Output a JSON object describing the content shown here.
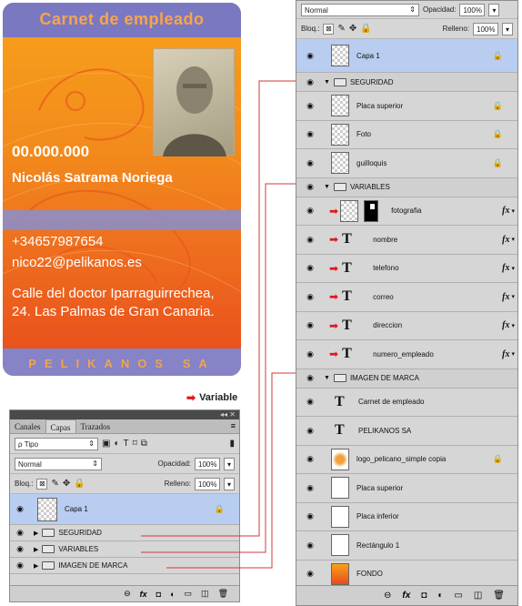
{
  "card": {
    "title": "Carnet de empleado",
    "number": "00.000.000",
    "name": "Nicolás Satrama Noriega",
    "phone": "+34657987654",
    "email": "nico22@pelikanos.es",
    "address": "Calle del doctor Iparraguirrechea, 24. Las Palmas de Gran Canaria.",
    "brand": "PELIKANOS SA"
  },
  "legend": {
    "label": "Variable",
    "color": "#e0171d"
  },
  "small_panel": {
    "tabs": [
      "Canales",
      "Capas",
      "Trazados"
    ],
    "filter": "Tipo",
    "blend": "Normal",
    "opacity_label": "Opacidad:",
    "opacity_value": "100%",
    "lock_label": "Bloq.:",
    "fill_label": "Relleno:",
    "fill_value": "100%",
    "layers": [
      {
        "name": "Capa 1",
        "type": "layer",
        "selected": true,
        "locked": true
      },
      {
        "name": "SEGURIDAD",
        "type": "group"
      },
      {
        "name": "VARIABLES",
        "type": "group"
      },
      {
        "name": "IMAGEN DE MARCA",
        "type": "group"
      }
    ]
  },
  "big_panel": {
    "blend": "Normal",
    "opacity_label": "Opacidad:",
    "opacity_value": "100%",
    "lock_label": "Bloq.:",
    "fill_label": "Relleno:",
    "fill_value": "100%",
    "layers": [
      {
        "name": "Capa 1",
        "type": "layer",
        "selected": true,
        "locked": true
      },
      {
        "name": "SEGURIDAD",
        "type": "group-open"
      },
      {
        "name": "Placa superior",
        "type": "layer",
        "locked": true
      },
      {
        "name": "Foto",
        "type": "layer",
        "locked": true
      },
      {
        "name": "guilloquis",
        "type": "layer",
        "locked": true
      },
      {
        "name": "VARIABLES",
        "type": "group-open"
      },
      {
        "name": "fotografia",
        "type": "image-variable"
      },
      {
        "name": "nombre",
        "type": "text-variable"
      },
      {
        "name": "telefono",
        "type": "text-variable"
      },
      {
        "name": "correo",
        "type": "text-variable"
      },
      {
        "name": "direccion",
        "type": "text-variable"
      },
      {
        "name": "numero_empleado",
        "type": "text-variable"
      },
      {
        "name": "IMAGEN DE MARCA",
        "type": "group-open"
      },
      {
        "name": "Carnet de empleado",
        "type": "text"
      },
      {
        "name": "PELIKANOS SA",
        "type": "text"
      },
      {
        "name": "logo_pelicano_simple copia",
        "type": "logo",
        "locked": true
      },
      {
        "name": "Placa superior",
        "type": "plaque"
      },
      {
        "name": "Placa inferior",
        "type": "plaque"
      },
      {
        "name": "Rectángulo 1",
        "type": "plaque"
      },
      {
        "name": "FONDO",
        "type": "fondo"
      }
    ]
  }
}
